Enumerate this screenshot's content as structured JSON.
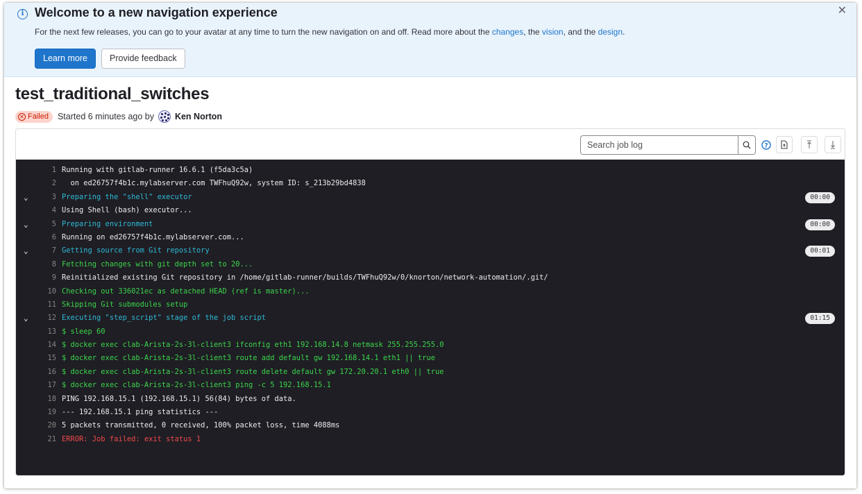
{
  "banner": {
    "title": "Welcome to a new navigation experience",
    "desc_pre": "For the next few releases, you can go to your avatar at any time to turn the new navigation on and off. Read more about the ",
    "link_changes": "changes",
    "desc_mid1": ", the ",
    "link_vision": "vision",
    "desc_mid2": ", and the ",
    "link_design": "design",
    "desc_end": ".",
    "learn_more": "Learn more",
    "provide_feedback": "Provide feedback",
    "close_glyph": "✕",
    "info_glyph": "i"
  },
  "job": {
    "title": "test_traditional_switches",
    "status": "Failed",
    "started": "Started 6 minutes ago by",
    "author": "Ken Norton"
  },
  "toolbar": {
    "search_placeholder": "Search job log"
  },
  "colors": {
    "accent": "#1f75cb",
    "failed": "#c91c00",
    "log_bg": "#1f1e24",
    "section": "#2eb8d6",
    "green": "#3bd44b",
    "error": "#ef4a4a"
  },
  "log_lines": [
    {
      "n": "1",
      "text": "Running with gitlab-runner 16.6.1 (f5da3c5a)",
      "color": "white"
    },
    {
      "n": "2",
      "text": "  on ed26757f4b1c.mylabserver.com TWFhuQ92w, system ID: s_213b29bd4838",
      "color": "white"
    },
    {
      "n": "3",
      "text": "Preparing the \"shell\" executor",
      "color": "cyan",
      "caret": true,
      "dur": "00:00"
    },
    {
      "n": "4",
      "text": "Using Shell (bash) executor...",
      "color": "white"
    },
    {
      "n": "5",
      "text": "Preparing environment",
      "color": "cyan",
      "caret": true,
      "dur": "00:00"
    },
    {
      "n": "6",
      "text": "Running on ed26757f4b1c.mylabserver.com...",
      "color": "white"
    },
    {
      "n": "7",
      "text": "Getting source from Git repository",
      "color": "cyan",
      "caret": true,
      "dur": "00:01"
    },
    {
      "n": "8",
      "text": "Fetching changes with git depth set to 20...",
      "color": "green"
    },
    {
      "n": "9",
      "text": "Reinitialized existing Git repository in /home/gitlab-runner/builds/TWFhuQ92w/0/knorton/network-automation/.git/",
      "color": "white"
    },
    {
      "n": "10",
      "text": "Checking out 336021ec as detached HEAD (ref is master)...",
      "color": "green"
    },
    {
      "n": "11",
      "text": "Skipping Git submodules setup",
      "color": "green"
    },
    {
      "n": "12",
      "text": "Executing \"step_script\" stage of the job script",
      "color": "cyan",
      "caret": true,
      "dur": "01:15"
    },
    {
      "n": "13",
      "text": "$ sleep 60",
      "color": "green"
    },
    {
      "n": "14",
      "text": "$ docker exec clab-Arista-2s-3l-client3 ifconfig eth1 192.168.14.8 netmask 255.255.255.0",
      "color": "green"
    },
    {
      "n": "15",
      "text": "$ docker exec clab-Arista-2s-3l-client3 route add default gw 192.168.14.1 eth1 || true",
      "color": "green"
    },
    {
      "n": "16",
      "text": "$ docker exec clab-Arista-2s-3l-client3 route delete default gw 172.20.20.1 eth0 || true",
      "color": "green"
    },
    {
      "n": "17",
      "text": "$ docker exec clab-Arista-2s-3l-client3 ping -c 5 192.168.15.1",
      "color": "green"
    },
    {
      "n": "18",
      "text": "PING 192.168.15.1 (192.168.15.1) 56(84) bytes of data.",
      "color": "white"
    },
    {
      "n": "19",
      "text": "--- 192.168.15.1 ping statistics ---",
      "color": "white"
    },
    {
      "n": "20",
      "text": "5 packets transmitted, 0 received, 100% packet loss, time 4088ms",
      "color": "white"
    },
    {
      "n": "21",
      "text": "ERROR: Job failed: exit status 1",
      "color": "red"
    }
  ]
}
